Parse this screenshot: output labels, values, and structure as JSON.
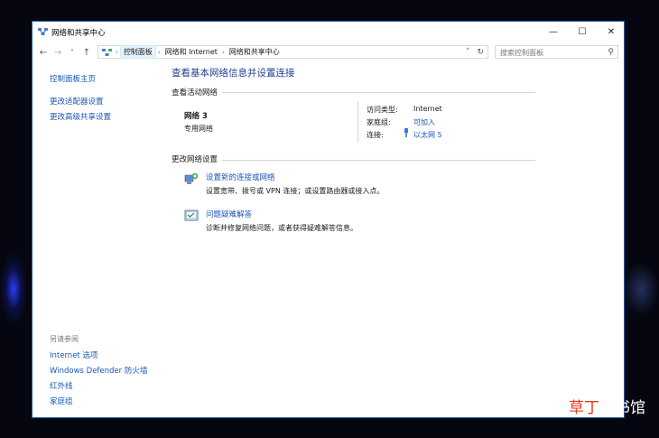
{
  "window": {
    "title": "网络和共享中心",
    "minimize_glyph": "—",
    "maximize_glyph": "☐",
    "close_glyph": "✕"
  },
  "navigation": {
    "back_glyph": "←",
    "forward_glyph": "→",
    "recent_glyph": "˅",
    "up_glyph": "↑"
  },
  "address_bar": {
    "crumbs": [
      "控制面板",
      "网络和 Internet",
      "网络和共享中心"
    ],
    "separator": "›",
    "dropdown_glyph": "˅",
    "refresh_glyph": "↻"
  },
  "search": {
    "placeholder": "搜索控制面板",
    "icon_glyph": "⚲"
  },
  "sidebar": {
    "items": [
      "控制面板主页",
      "更改适配器设置",
      "更改高级共享设置"
    ],
    "see_also_heading": "另请参阅",
    "see_also": [
      "Internet 选项",
      "Windows Defender 防火墙",
      "红外线",
      "家庭组"
    ]
  },
  "main": {
    "title": "查看基本网络信息并设置连接",
    "active_networks_heading": "查看活动网络",
    "network": {
      "name": "网络  3",
      "category": "专用网络",
      "access_type_label": "访问类型:",
      "access_type_value": "Internet",
      "homegroup_label": "家庭组:",
      "homegroup_value": "可加入",
      "connections_label": "连接:",
      "connections_value": "以太网 5"
    },
    "change_settings_heading": "更改网络设置",
    "tasks": [
      {
        "link": "设置新的连接或网络",
        "description": "设置宽带、拨号或 VPN 连接；或设置路由器或接入点。",
        "icon": "new-connection-icon"
      },
      {
        "link": "问题疑难解答",
        "description": "诊断并修复网络问题，或者获得疑难解答信息。",
        "icon": "troubleshoot-icon"
      }
    ]
  },
  "watermark": {
    "red_text": "草丁",
    "white_text": "图书馆"
  },
  "colors": {
    "link": "#1a56b8",
    "title": "#1e3f8f",
    "window_border": "#1e5fa8",
    "background": "#05060f"
  }
}
